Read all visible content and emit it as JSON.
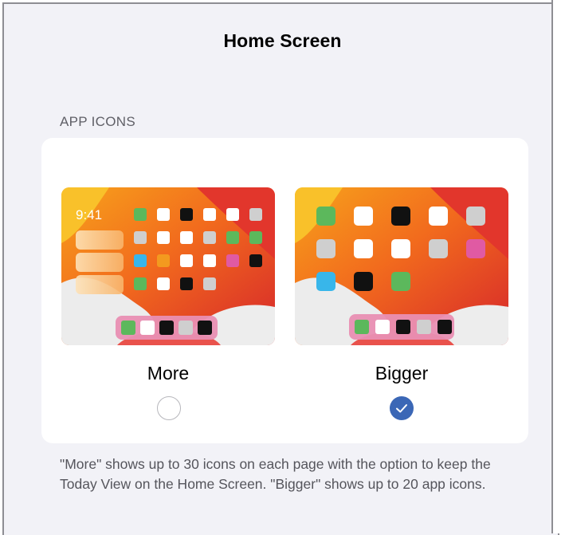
{
  "page": {
    "title": "Home Screen"
  },
  "section": {
    "label": "APP ICONS"
  },
  "options": [
    {
      "label": "More",
      "selected": false,
      "preview_time": "9:41"
    },
    {
      "label": "Bigger",
      "selected": true
    }
  ],
  "footnote": "\"More\" shows up to 30 icons on each page with the option to keep the Today View on the Home Screen. \"Bigger\" shows up to 20 app icons.",
  "colors": {
    "accent": "#3b67b6",
    "background": "#f2f2f7",
    "card": "#ffffff",
    "icon_green": "#5cb85c",
    "icon_blue": "#38b6ea",
    "icon_pink": "#e05aa3",
    "icon_orange": "#f39a1f"
  },
  "icons": {
    "selected": "checkmark-icon"
  }
}
